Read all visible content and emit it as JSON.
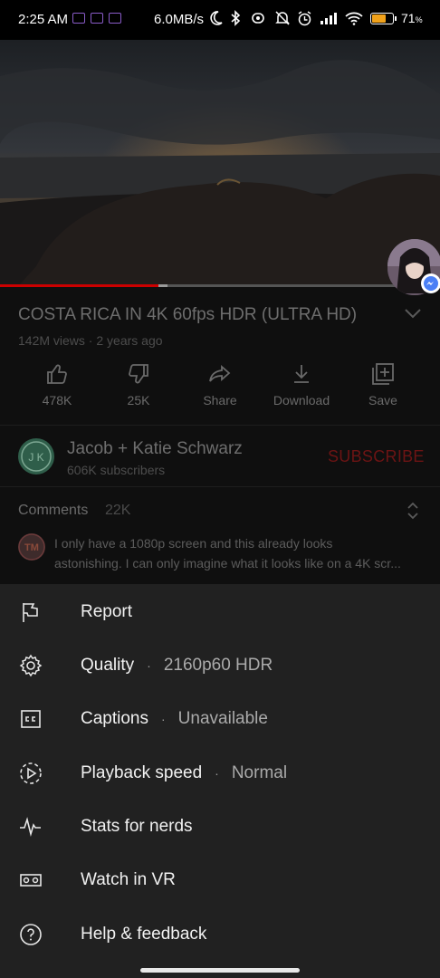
{
  "status_bar": {
    "time": "2:25 AM",
    "speed": "6.0MB/s",
    "battery_percent": "71",
    "battery_level": 0.71
  },
  "video": {
    "progress_fraction": 0.36,
    "buffer_fraction": 0.02
  },
  "details": {
    "title": "COSTA RICA IN 4K 60fps HDR (ULTRA HD)",
    "meta": "142M views · 2 years ago",
    "actions": [
      {
        "label": "478K",
        "icon": "thumbs-up-icon"
      },
      {
        "label": "25K",
        "icon": "thumbs-down-icon"
      },
      {
        "label": "Share",
        "icon": "share-icon"
      },
      {
        "label": "Download",
        "icon": "download-icon"
      },
      {
        "label": "Save",
        "icon": "save-to-playlist-icon"
      }
    ]
  },
  "channel": {
    "name": "Jacob + Katie Schwarz",
    "subscribers": "606K subscribers",
    "subscribe_label": "SUBSCRIBE"
  },
  "comments": {
    "heading": "Comments",
    "count": "22K",
    "avatar_initials": "TM",
    "preview_line1": "I only have a 1080p screen and this already looks",
    "preview_line2": "astonishing. I can only imagine what it looks like on a 4K scr..."
  },
  "menu": {
    "report": "Report",
    "quality": "Quality",
    "quality_value": "2160p60 HDR",
    "captions": "Captions",
    "captions_value": "Unavailable",
    "playback_speed": "Playback speed",
    "playback_value": "Normal",
    "stats": "Stats for nerds",
    "vr": "Watch in VR",
    "help": "Help & feedback",
    "separator": "·"
  },
  "colors": {
    "sheet_bg": "#212121",
    "page_bg": "#0f0f0f",
    "subscribe_red": "#cc0000",
    "progress_red": "#cc0000",
    "battery_orange": "#f0a11a"
  }
}
